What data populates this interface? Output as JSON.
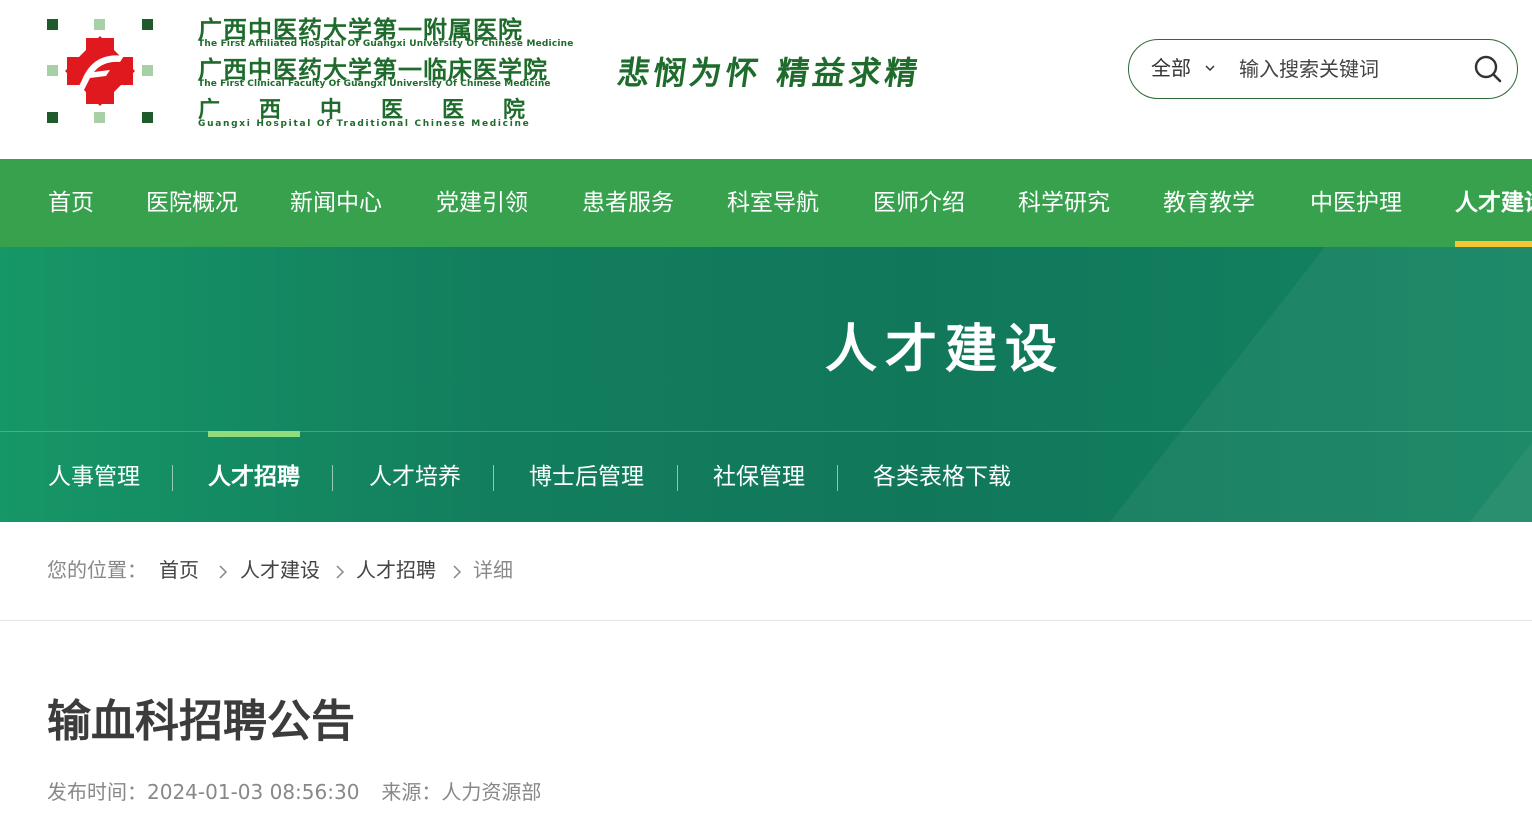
{
  "header": {
    "logo": {
      "cn_line1": "广西中医药大学第一附属医院",
      "en_line1": "The First Affiliated Hospital Of Guangxi University Of Chinese Medicine",
      "cn_line2": "广西中医药大学第一临床医学院",
      "en_line2": "The First Clinical Faculty Of Guangxi University Of Chinese Medicine",
      "cn_line3": "广西中医医院",
      "en_line3": "Guangxi Hospital Of Traditional Chinese Medicine"
    },
    "motto": "悲悯为怀 精益求精",
    "search": {
      "scope": "全部",
      "placeholder": "输入搜索关键词"
    }
  },
  "main_nav": [
    {
      "label": "首页"
    },
    {
      "label": "医院概况"
    },
    {
      "label": "新闻中心"
    },
    {
      "label": "党建引领"
    },
    {
      "label": "患者服务"
    },
    {
      "label": "科室导航"
    },
    {
      "label": "医师介绍"
    },
    {
      "label": "科学研究"
    },
    {
      "label": "教育教学"
    },
    {
      "label": "中医护理"
    },
    {
      "label": "人才建设",
      "active": true
    }
  ],
  "banner": {
    "title": "人才建设"
  },
  "sub_nav": [
    {
      "label": "人事管理"
    },
    {
      "label": "人才招聘",
      "active": true
    },
    {
      "label": "人才培养"
    },
    {
      "label": "博士后管理"
    },
    {
      "label": "社保管理"
    },
    {
      "label": "各类表格下载"
    }
  ],
  "breadcrumb": {
    "prefix": "您的位置：",
    "items": [
      "首页",
      "人才建设",
      "人才招聘"
    ],
    "current": "详细"
  },
  "article": {
    "title": "输血科招聘公告",
    "publish_label": "发布时间：",
    "publish_time": "2024-01-03 08:56:30",
    "source_label": "来源：",
    "source": "人力资源部"
  },
  "colors": {
    "nav_green": "#37a14e",
    "banner_green": "#11775b",
    "accent_yellow": "#f3c633",
    "logo_green": "#1e6b2c",
    "logo_red": "#e0191e"
  }
}
